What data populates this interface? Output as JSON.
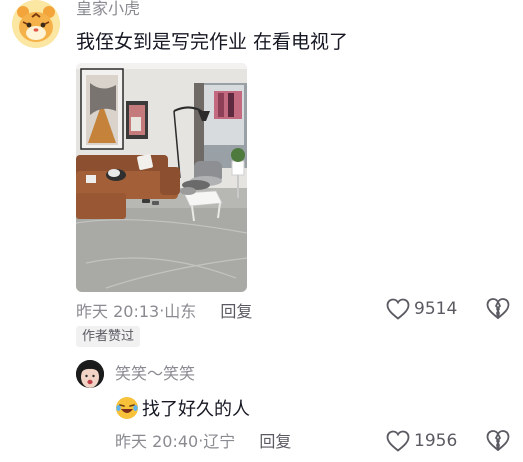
{
  "main_comment": {
    "username": "皇家小虎",
    "text": "我侄女到是写完作业 在看电视了",
    "time": "昨天 20:13",
    "location": "山东",
    "separator": " · ",
    "reply_label": "回复",
    "like_count": "9514",
    "author_badge": "作者赞过"
  },
  "reply_comment": {
    "username": "笑笑～笑笑",
    "text": "找了好久的人",
    "time": "昨天 20:40",
    "location": "辽宁",
    "separator": " · ",
    "reply_label": "回复",
    "like_count": "1956"
  },
  "colors": {
    "secondary_text": "#8a8b91",
    "primary_text": "#161823",
    "badge_bg": "#f1f1f2"
  }
}
